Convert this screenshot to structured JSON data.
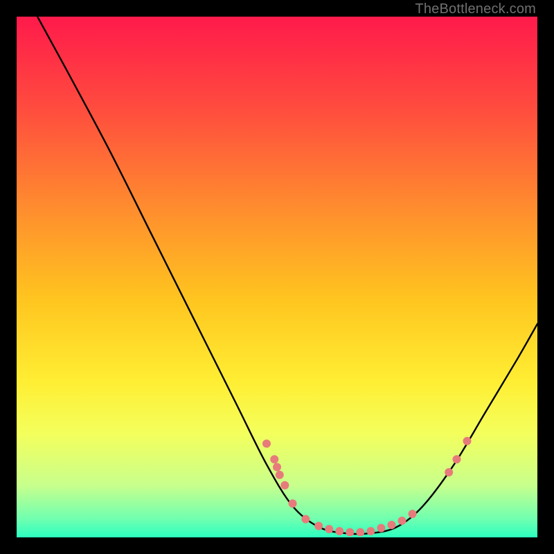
{
  "watermark": "TheBottleneck.com",
  "chart_data": {
    "type": "line",
    "title": "",
    "xlabel": "",
    "ylabel": "",
    "xlim": [
      0,
      100
    ],
    "ylim": [
      0,
      100
    ],
    "grid": false,
    "legend": false,
    "background_gradient": {
      "stops": [
        {
          "offset": 0.0,
          "color": "#ff1a4b"
        },
        {
          "offset": 0.18,
          "color": "#ff4d3e"
        },
        {
          "offset": 0.36,
          "color": "#ff8a2f"
        },
        {
          "offset": 0.54,
          "color": "#ffc41f"
        },
        {
          "offset": 0.7,
          "color": "#ffee33"
        },
        {
          "offset": 0.8,
          "color": "#f4ff5c"
        },
        {
          "offset": 0.9,
          "color": "#c8ff8c"
        },
        {
          "offset": 0.965,
          "color": "#6fffb0"
        },
        {
          "offset": 1.0,
          "color": "#2bffc0"
        }
      ]
    },
    "curve": {
      "name": "bottleneck-curve",
      "points": [
        {
          "x": 4,
          "y": 100
        },
        {
          "x": 10,
          "y": 89
        },
        {
          "x": 18,
          "y": 74
        },
        {
          "x": 26,
          "y": 58
        },
        {
          "x": 34,
          "y": 42
        },
        {
          "x": 42,
          "y": 26
        },
        {
          "x": 48,
          "y": 14
        },
        {
          "x": 53,
          "y": 6
        },
        {
          "x": 58,
          "y": 2
        },
        {
          "x": 63,
          "y": 0.8
        },
        {
          "x": 68,
          "y": 0.8
        },
        {
          "x": 73,
          "y": 2
        },
        {
          "x": 78,
          "y": 6
        },
        {
          "x": 84,
          "y": 14
        },
        {
          "x": 90,
          "y": 24
        },
        {
          "x": 96,
          "y": 34
        },
        {
          "x": 100,
          "y": 41
        }
      ]
    },
    "markers": [
      {
        "x": 48.0,
        "y": 18.0
      },
      {
        "x": 49.5,
        "y": 15.0
      },
      {
        "x": 50.0,
        "y": 13.5
      },
      {
        "x": 50.5,
        "y": 12.0
      },
      {
        "x": 51.5,
        "y": 10.0
      },
      {
        "x": 53.0,
        "y": 6.5
      },
      {
        "x": 55.5,
        "y": 3.5
      },
      {
        "x": 58.0,
        "y": 2.2
      },
      {
        "x": 60.0,
        "y": 1.6
      },
      {
        "x": 62.0,
        "y": 1.2
      },
      {
        "x": 64.0,
        "y": 1.0
      },
      {
        "x": 66.0,
        "y": 1.0
      },
      {
        "x": 68.0,
        "y": 1.2
      },
      {
        "x": 70.0,
        "y": 1.8
      },
      {
        "x": 72.0,
        "y": 2.4
      },
      {
        "x": 74.0,
        "y": 3.2
      },
      {
        "x": 76.0,
        "y": 4.5
      },
      {
        "x": 83.0,
        "y": 12.5
      },
      {
        "x": 84.5,
        "y": 15.0
      },
      {
        "x": 86.5,
        "y": 18.5
      }
    ],
    "marker_color": "#e77b7b",
    "marker_radius": 6
  }
}
